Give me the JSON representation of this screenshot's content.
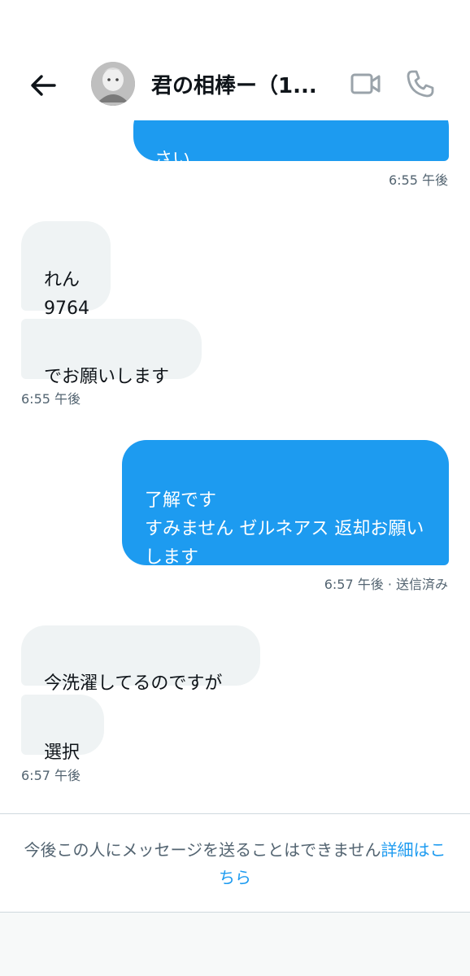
{
  "header": {
    "title": "君の相棒ー（1...",
    "back_icon": "arrow-left-icon",
    "video_icon": "video-camera-icon",
    "phone_icon": "phone-icon",
    "icon_color": "#9aa3aa"
  },
  "messages": [
    {
      "side": "sent",
      "text": "さい",
      "time": "6:55 午後"
    },
    {
      "side": "received",
      "text": "れん\n9764"
    },
    {
      "side": "received",
      "text": "でお願いします",
      "time": "6:55 午後"
    },
    {
      "side": "sent",
      "text": "了解です\nすみません ゼルネアス 返却お願いします",
      "time": "6:57 午後 · 送信済み"
    },
    {
      "side": "received",
      "text": "今洗濯してるのですが"
    },
    {
      "side": "received",
      "text": "選択",
      "time": "6:57 午後"
    }
  ],
  "notice": {
    "text": "今後この人にメッセージを送ることはできません",
    "link": "詳細はこちら"
  },
  "colors": {
    "sent_bubble": "#1d9bf0",
    "received_bubble": "#eff3f4",
    "link": "#1d9bf0",
    "muted_text": "#536471"
  }
}
